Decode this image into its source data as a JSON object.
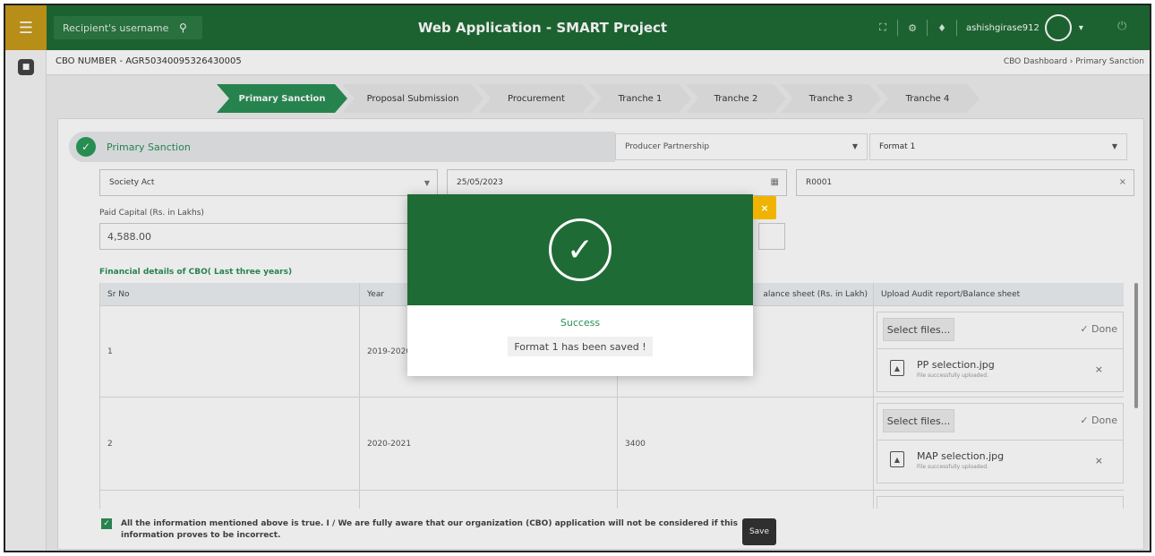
{
  "topbar": {
    "search_placeholder": "Recipient's username",
    "title": "Web Application - SMART Project",
    "username": "ashishgirase912"
  },
  "header": {
    "cbo_number": "CBO NUMBER - AGR50340095326430005",
    "breadcrumb": "CBO Dashboard  ›  Primary Sanction"
  },
  "steps": [
    "Primary Sanction",
    "Proposal Submission",
    "Procurement",
    "Tranche 1",
    "Tranche 2",
    "Tranche 3",
    "Tranche 4"
  ],
  "form": {
    "section_title": "Primary Sanction",
    "partnership_select": "Producer Partnership",
    "format_select": "Format 1",
    "act_select": "Society Act",
    "date": "25/05/2023",
    "code": "R0001",
    "paid_capital_label": "Paid Capital (Rs. in Lakhs)",
    "paid_capital_value": "4,588.00",
    "financial_title": "Financial details of CBO( Last three years)"
  },
  "table": {
    "headers": [
      "Sr No",
      "Year",
      "alance sheet (Rs. in Lakh)",
      "Upload Audit report/Balance sheet"
    ],
    "rows": [
      {
        "sr": "1",
        "year": "2019-2020",
        "value": "",
        "file": "PP selection.jpg"
      },
      {
        "sr": "2",
        "year": "2020-2021",
        "value": "3400",
        "file": "MAP selection.jpg"
      }
    ],
    "select_files_label": "Select files...",
    "done_label": "✓ Done",
    "file_status": "File successfully uploaded."
  },
  "footer": {
    "declaration": "All the information mentioned above is true. I / We are fully aware that our organization (CBO) application will not be considered if this information proves to be incorrect.",
    "save_label": "Save"
  },
  "modal": {
    "title": "Success",
    "message": "Format 1 has been saved !"
  }
}
